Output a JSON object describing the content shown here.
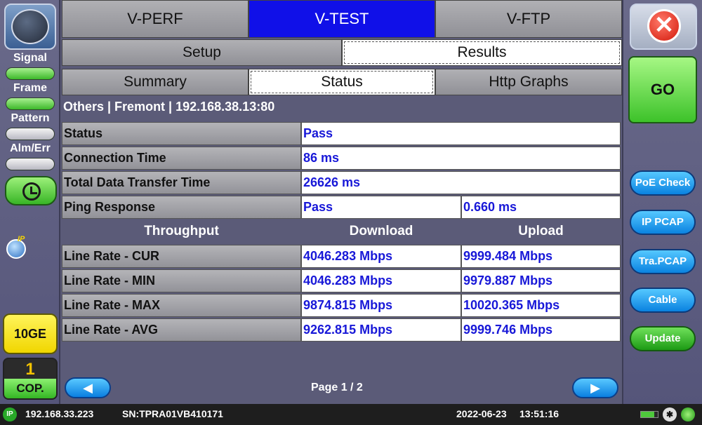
{
  "left_rail": {
    "signal_label": "Signal",
    "frame_label": "Frame",
    "pattern_label": "Pattern",
    "alm_err_label": "Alm/Err",
    "ip_tag": "IP",
    "rate_label": "10GE",
    "cop_number": "1",
    "cop_label": "COP."
  },
  "right_rail": {
    "close_glyph": "✕",
    "go_label": "GO",
    "buttons": [
      "PoE Check",
      "IP PCAP",
      "Tra.PCAP",
      "Cable",
      "Update"
    ]
  },
  "tabs": {
    "top": [
      "V-PERF",
      "V-TEST",
      "V-FTP"
    ],
    "top_active": "V-TEST",
    "sub": [
      "Setup",
      "Results"
    ],
    "sub_selected": "Results",
    "sub2": [
      "Summary",
      "Status",
      "Http Graphs"
    ],
    "sub2_selected": "Status"
  },
  "info_line": "Others | Fremont | 192.168.38.13:80",
  "status_rows": [
    {
      "label": "Status",
      "value": "Pass"
    },
    {
      "label": "Connection Time",
      "value": "86 ms"
    },
    {
      "label": "Total Data Transfer Time",
      "value": "26626 ms"
    }
  ],
  "ping_row": {
    "label": "Ping Response",
    "value": "Pass",
    "time": "0.660 ms"
  },
  "throughput_header": {
    "col1": "Throughput",
    "col2": "Download",
    "col3": "Upload"
  },
  "throughput_rows": [
    {
      "label": "Line Rate - CUR",
      "download": "4046.283 Mbps",
      "upload": "9999.484 Mbps"
    },
    {
      "label": "Line Rate - MIN",
      "download": "4046.283 Mbps",
      "upload": "9979.887 Mbps"
    },
    {
      "label": "Line Rate - MAX",
      "download": "9874.815 Mbps",
      "upload": "10020.365 Mbps"
    },
    {
      "label": "Line Rate - AVG",
      "download": "9262.815 Mbps",
      "upload": "9999.746 Mbps"
    }
  ],
  "pager": {
    "prev": "◀",
    "next": "▶",
    "page_text": "Page 1 / 2"
  },
  "statusbar": {
    "ip_badge": "IP",
    "ip": "192.168.33.223",
    "sn": "SN:TPRA01VB410171",
    "date": "2022-06-23",
    "time": "13:51:16",
    "bt_glyph": "✱"
  }
}
